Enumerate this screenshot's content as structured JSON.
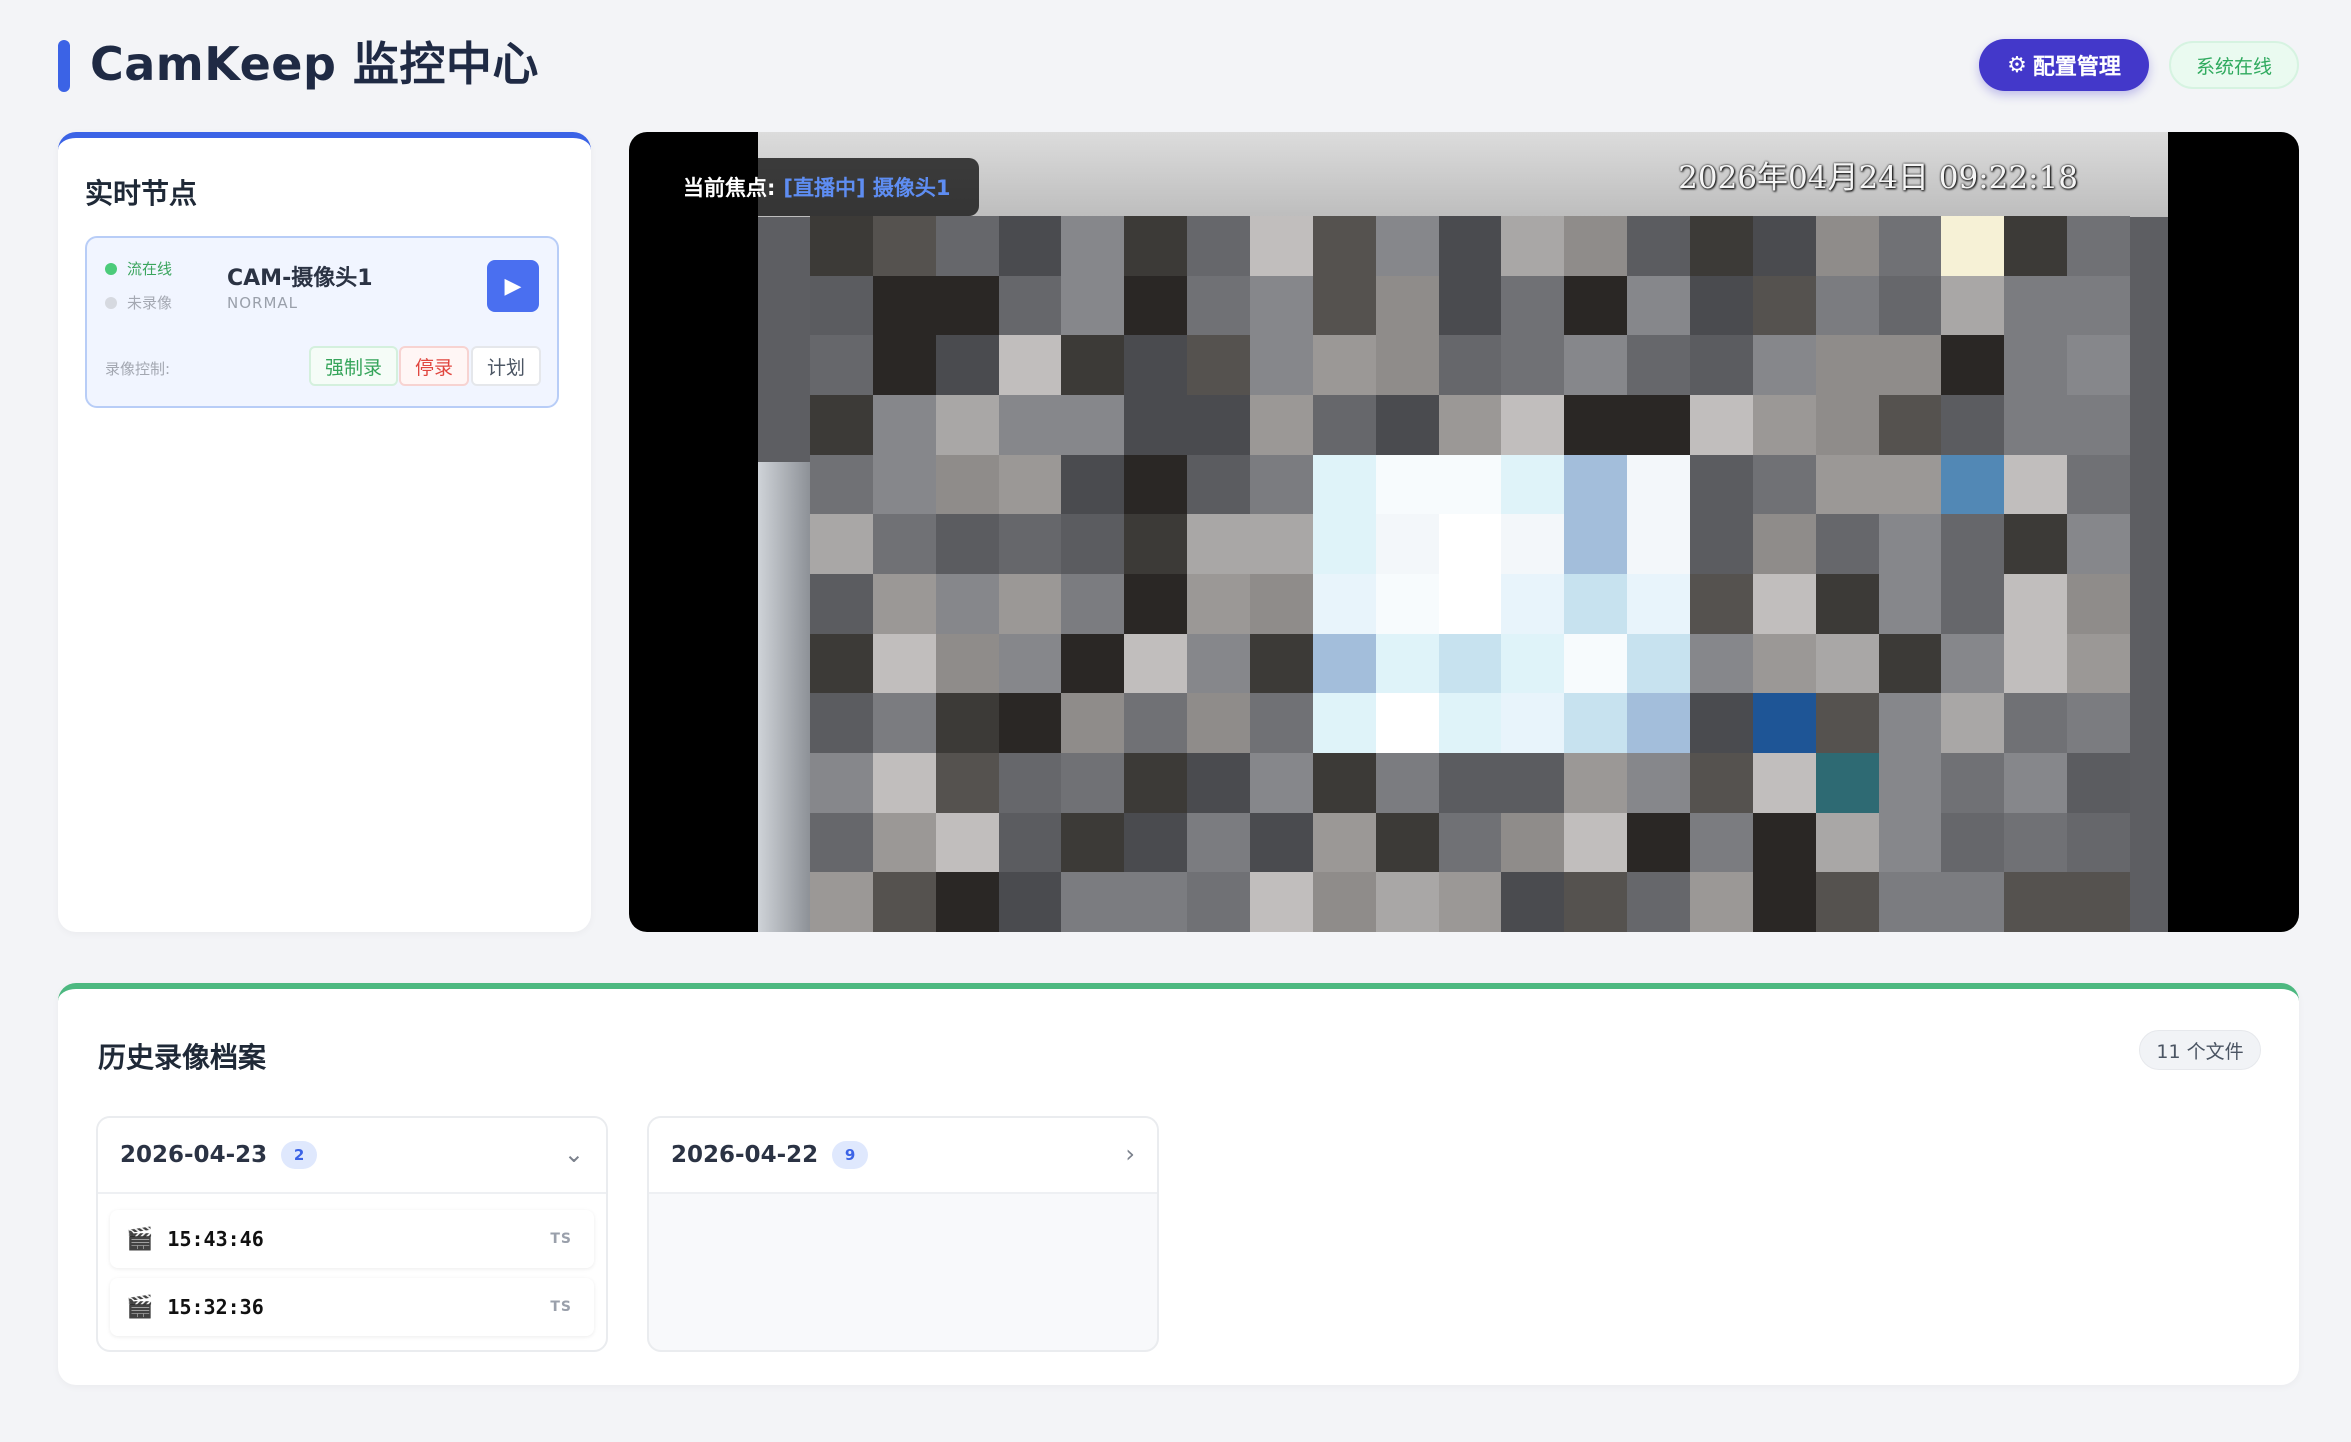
{
  "header": {
    "title": "CamKeep 监控中心",
    "config_button": "配置管理",
    "config_icon": "⚙",
    "system_status": "系统在线"
  },
  "nodes": {
    "title": "实时节点",
    "cameras": [
      {
        "stream_status": "流在线",
        "record_status": "未录像",
        "name": "CAM-摄像头1",
        "mode": "NORMAL",
        "play_icon": "▶",
        "record_label": "录像控制:",
        "force_record": "强制录",
        "stop_record": "停录",
        "schedule": "计划"
      }
    ]
  },
  "player": {
    "focus_label": "当前焦点:",
    "focus_value": "[直播中] 摄像头1",
    "timestamp": "2026年04月24日 09:22:18"
  },
  "history": {
    "title": "历史录像档案",
    "file_count": "11 个文件",
    "groups": [
      {
        "date": "2026-04-23",
        "count": "2",
        "chevron": "⌄",
        "files": [
          {
            "icon": "🎬",
            "time": "15:43:46",
            "type": "TS"
          },
          {
            "icon": "🎬",
            "time": "15:32:36",
            "type": "TS"
          }
        ]
      },
      {
        "date": "2026-04-22",
        "count": "9",
        "chevron": "›",
        "files": []
      }
    ]
  },
  "colors": {
    "accent": "#3b63e6",
    "config_btn": "#4338ca",
    "online_green": "#2faa5e",
    "history_accent": "#4cb880"
  }
}
